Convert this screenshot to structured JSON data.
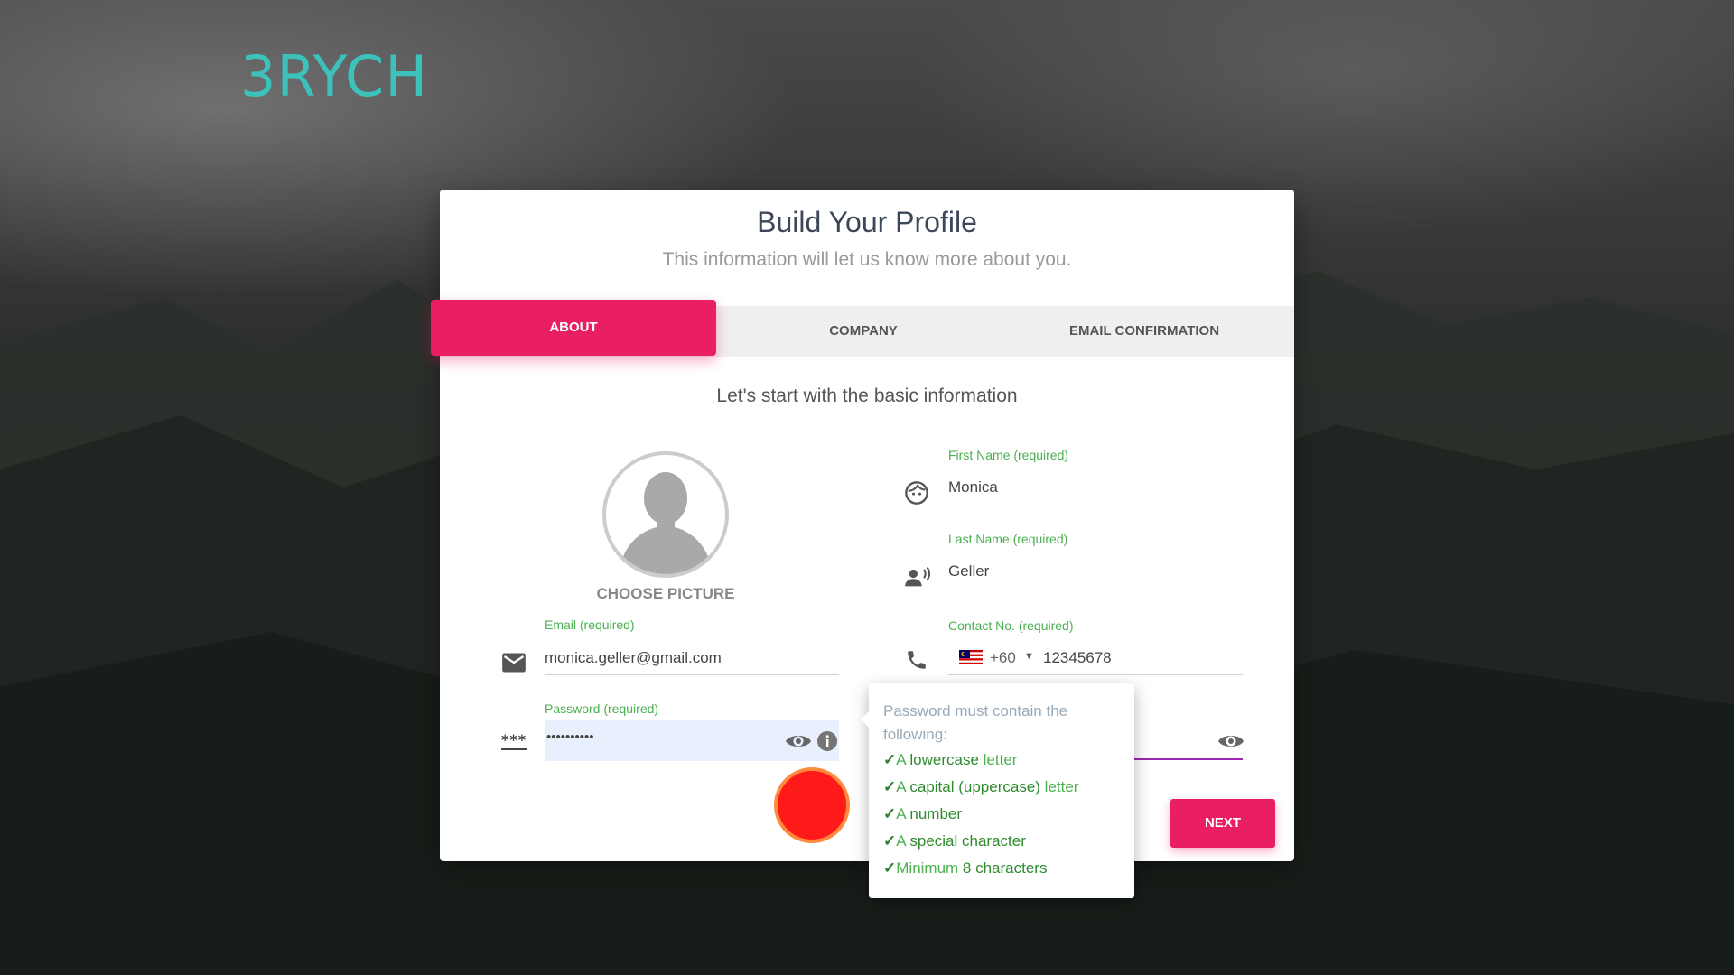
{
  "brand": {
    "logo_text": "3RYCH",
    "accent": "#3cc1bb"
  },
  "card": {
    "title": "Build Your Profile",
    "subtitle": "This information will let us know more about you.",
    "tabs": [
      {
        "label": "ABOUT",
        "active": true
      },
      {
        "label": "COMPANY",
        "active": false
      },
      {
        "label": "EMAIL CONFIRMATION",
        "active": false
      }
    ],
    "section_heading": "Let's start with the basic information",
    "choose_picture": "CHOOSE PICTURE"
  },
  "form": {
    "first_name": {
      "label": "First Name (required)",
      "value": "Monica",
      "icon": "face-icon"
    },
    "last_name": {
      "label": "Last Name (required)",
      "value": "Geller",
      "icon": "record-voice-icon"
    },
    "email": {
      "label": "Email (required)",
      "value": "monica.geller@gmail.com",
      "icon": "mail-icon"
    },
    "contact": {
      "label": "Contact No. (required)",
      "country_code": "+60",
      "value": "12345678",
      "icon": "phone-icon",
      "flag": "malaysia-flag-icon"
    },
    "password": {
      "label": "Password (required)",
      "value": "••••••••••",
      "icon": "password-icon"
    },
    "confirm_password_icon": "eye-icon"
  },
  "password_tooltip": {
    "title": "Password must contain the following:",
    "requirements": [
      {
        "check": "✓",
        "prefix": "A ",
        "strong": "lowercase",
        "suffix": " letter"
      },
      {
        "check": "✓",
        "prefix": "A ",
        "strong": "capital (uppercase)",
        "suffix": " letter"
      },
      {
        "check": "✓",
        "prefix": "A ",
        "strong": "number",
        "suffix": ""
      },
      {
        "check": "✓",
        "prefix": "A ",
        "strong": "special character",
        "suffix": ""
      },
      {
        "check": "✓",
        "prefix": "Minimum ",
        "strong": "8 characters",
        "suffix": ""
      }
    ]
  },
  "buttons": {
    "next": "NEXT"
  },
  "colors": {
    "primary": "#e91e63",
    "label_green": "#4caf50",
    "focus_purple": "#9c27b0"
  }
}
